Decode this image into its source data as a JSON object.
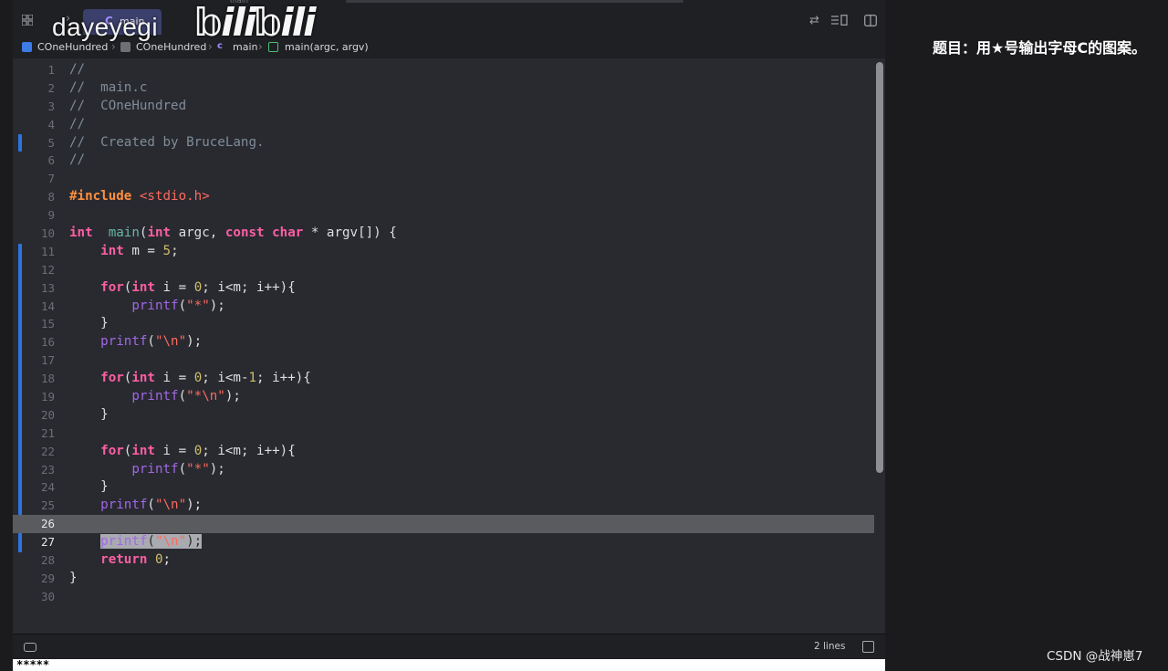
{
  "watermark": {
    "user": "dayeyegi",
    "brand": "bilibili"
  },
  "top_handle": "main",
  "tabbar": {
    "tab_label": "main",
    "tab_icon": "C"
  },
  "breadcrumb": {
    "items": [
      {
        "label": "COneHundred",
        "icon": "xcode-project-icon"
      },
      {
        "label": "COneHundred",
        "icon": "folder-icon"
      },
      {
        "label": "main",
        "icon": "c-file-icon"
      },
      {
        "label": "main(argc, argv)",
        "icon": "function-icon"
      }
    ]
  },
  "editor": {
    "active_lines": [
      26,
      27
    ],
    "lines": [
      {
        "n": "1",
        "code": [
          [
            "c-com",
            "//"
          ]
        ]
      },
      {
        "n": "2",
        "code": [
          [
            "c-com",
            "//  main.c"
          ]
        ]
      },
      {
        "n": "3",
        "code": [
          [
            "c-com",
            "//  COneHundred"
          ]
        ]
      },
      {
        "n": "4",
        "code": [
          [
            "c-com",
            "//"
          ]
        ]
      },
      {
        "n": "5",
        "code": [
          [
            "c-com",
            "//  Created by BruceLang."
          ]
        ]
      },
      {
        "n": "6",
        "code": [
          [
            "c-com",
            "//"
          ]
        ]
      },
      {
        "n": "7",
        "code": []
      },
      {
        "n": "8",
        "code": [
          [
            "c-pre",
            "#include "
          ],
          [
            "c-inc",
            "<stdio.h>"
          ]
        ]
      },
      {
        "n": "9",
        "code": []
      },
      {
        "n": "10",
        "code": [
          [
            "c-kw",
            "int"
          ],
          [
            "",
            "  "
          ],
          [
            "c-fn",
            "main"
          ],
          [
            "",
            "("
          ],
          [
            "c-kw",
            "int"
          ],
          [
            "",
            " argc, "
          ],
          [
            "c-kw",
            "const"
          ],
          [
            "",
            " "
          ],
          [
            "c-kw",
            "char"
          ],
          [
            "",
            " * argv[]) {"
          ]
        ]
      },
      {
        "n": "11",
        "code": [
          [
            "",
            "    "
          ],
          [
            "c-kw",
            "int"
          ],
          [
            "",
            " m = "
          ],
          [
            "c-num",
            "5"
          ],
          [
            "",
            ";"
          ]
        ]
      },
      {
        "n": "12",
        "code": []
      },
      {
        "n": "13",
        "code": [
          [
            "",
            "    "
          ],
          [
            "c-kw",
            "for"
          ],
          [
            "",
            "("
          ],
          [
            "c-kw",
            "int"
          ],
          [
            "",
            " i = "
          ],
          [
            "c-num",
            "0"
          ],
          [
            "",
            "; i<m; i++){"
          ]
        ]
      },
      {
        "n": "14",
        "code": [
          [
            "",
            "        "
          ],
          [
            "c-call",
            "printf"
          ],
          [
            "",
            "("
          ],
          [
            "c-str",
            "\"*\""
          ],
          [
            "",
            ");"
          ]
        ]
      },
      {
        "n": "15",
        "code": [
          [
            "",
            "    }"
          ]
        ]
      },
      {
        "n": "16",
        "code": [
          [
            "",
            "    "
          ],
          [
            "c-call",
            "printf"
          ],
          [
            "",
            "("
          ],
          [
            "c-str",
            "\"\\n\""
          ],
          [
            "",
            ");"
          ]
        ]
      },
      {
        "n": "17",
        "code": []
      },
      {
        "n": "18",
        "code": [
          [
            "",
            "    "
          ],
          [
            "c-kw",
            "for"
          ],
          [
            "",
            "("
          ],
          [
            "c-kw",
            "int"
          ],
          [
            "",
            " i = "
          ],
          [
            "c-num",
            "0"
          ],
          [
            "",
            "; i<m-"
          ],
          [
            "c-num",
            "1"
          ],
          [
            "",
            "; i++){"
          ]
        ]
      },
      {
        "n": "19",
        "code": [
          [
            "",
            "        "
          ],
          [
            "c-call",
            "printf"
          ],
          [
            "",
            "("
          ],
          [
            "c-str",
            "\"*\\n\""
          ],
          [
            "",
            ");"
          ]
        ]
      },
      {
        "n": "20",
        "code": [
          [
            "",
            "    }"
          ]
        ]
      },
      {
        "n": "21",
        "code": []
      },
      {
        "n": "22",
        "code": [
          [
            "",
            "    "
          ],
          [
            "c-kw",
            "for"
          ],
          [
            "",
            "("
          ],
          [
            "c-kw",
            "int"
          ],
          [
            "",
            " i = "
          ],
          [
            "c-num",
            "0"
          ],
          [
            "",
            "; i<m; i++){"
          ]
        ]
      },
      {
        "n": "23",
        "code": [
          [
            "",
            "        "
          ],
          [
            "c-call",
            "printf"
          ],
          [
            "",
            "("
          ],
          [
            "c-str",
            "\"*\""
          ],
          [
            "",
            ");"
          ]
        ]
      },
      {
        "n": "24",
        "code": [
          [
            "",
            "    }"
          ]
        ]
      },
      {
        "n": "25",
        "code": [
          [
            "",
            "    "
          ],
          [
            "c-call",
            "printf"
          ],
          [
            "",
            "("
          ],
          [
            "c-str",
            "\"\\n\""
          ],
          [
            "",
            ");"
          ]
        ]
      },
      {
        "n": "26",
        "code": [],
        "highlight": true
      },
      {
        "n": "27",
        "code": [
          [
            "",
            "    "
          ],
          [
            "c-call sel",
            "printf"
          ],
          [
            "sel",
            "("
          ],
          [
            "c-str sel",
            "\"\\n\""
          ],
          [
            "sel",
            ");"
          ]
        ]
      },
      {
        "n": "28",
        "code": [
          [
            "",
            "    "
          ],
          [
            "c-kw",
            "return"
          ],
          [
            "",
            " "
          ],
          [
            "c-num",
            "0"
          ],
          [
            "",
            ";"
          ]
        ]
      },
      {
        "n": "29",
        "code": [
          [
            "",
            "}"
          ]
        ]
      },
      {
        "n": "30",
        "code": []
      }
    ]
  },
  "statusbar": {
    "lines_label": "2 lines"
  },
  "console": {
    "output": "*****"
  },
  "right": {
    "question": "题目：用★号输出字母C的图案。",
    "credit": "CSDN @战神崽7"
  },
  "colors": {
    "accent": "#2b74e0",
    "background": "#292a30",
    "selection": "#5a5b5f"
  }
}
